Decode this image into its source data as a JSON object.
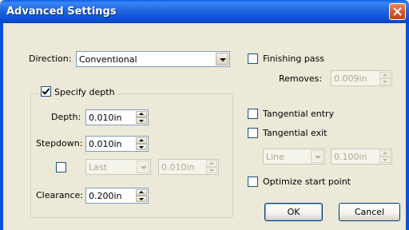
{
  "window": {
    "title": "Advanced Settings"
  },
  "direction": {
    "label": "Direction:",
    "value": "Conventional"
  },
  "depth_group": {
    "checkbox_label": "Specify depth",
    "depth": {
      "label": "Depth:",
      "value": "0.010in"
    },
    "stepdown": {
      "label": "Stepdown:",
      "value": "0.010in"
    },
    "last_pass": {
      "select_value": "Last",
      "value": "0.010in"
    },
    "clearance": {
      "label": "Clearance:",
      "value": "0.200in"
    }
  },
  "finishing": {
    "checkbox_label": "Finishing pass",
    "removes_label": "Removes:",
    "removes_value": "0.009in"
  },
  "tangential_entry": {
    "label": "Tangential entry"
  },
  "tangential_exit": {
    "label": "Tangential exit",
    "type_value": "Line",
    "length_value": "0.100in"
  },
  "optimize": {
    "label": "Optimize start point"
  },
  "buttons": {
    "ok": "OK",
    "cancel": "Cancel"
  }
}
